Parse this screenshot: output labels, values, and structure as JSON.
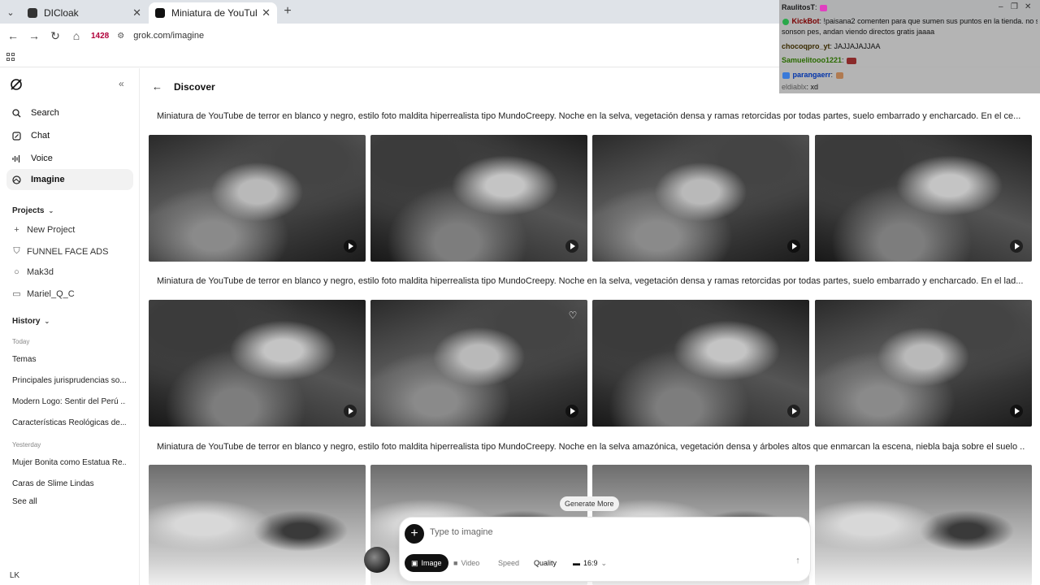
{
  "browser": {
    "tabs": [
      {
        "title": "DICloak",
        "favicon_color": "#333333"
      },
      {
        "title": "Miniatura de YouTube de terror",
        "favicon_color": "#111111"
      }
    ],
    "new_tab": "+",
    "badge_count": "1428",
    "url": "grok.com/imagine"
  },
  "sidebar": {
    "menu": [
      {
        "label": "Search",
        "icon": "search-icon"
      },
      {
        "label": "Chat",
        "icon": "chat-icon"
      },
      {
        "label": "Voice",
        "icon": "voice-icon"
      },
      {
        "label": "Imagine",
        "icon": "imagine-icon"
      }
    ],
    "projects_header": "Projects",
    "projects": [
      {
        "label": "New Project",
        "icon": "plus-icon"
      },
      {
        "label": "FUNNEL FACE ADS",
        "icon": "project-icon"
      },
      {
        "label": "Mak3d",
        "icon": "project-icon"
      },
      {
        "label": "Mariel_Q_C",
        "icon": "project-icon"
      }
    ],
    "history_header": "History",
    "today_label": "Today",
    "today": [
      "Temas",
      "Principales jurisprudencias so...",
      "Modern Logo: Sentir del Perú ...",
      "Características Reológicas de..."
    ],
    "yesterday_label": "Yesterday",
    "yesterday": [
      "Mujer Bonita como Estatua Re...",
      "Caras de Slime Lindas"
    ],
    "see_all": "See all",
    "avatar": "LK"
  },
  "main": {
    "title": "Discover",
    "prompts": [
      "Miniatura de YouTube de terror en blanco y negro, estilo foto maldita hiperrealista tipo MundoCreepy. Noche en la selva, vegetación densa y ramas retorcidas por todas partes, suelo embarrado y encharcado. En el ce...",
      "Miniatura de YouTube de terror en blanco y negro, estilo foto maldita hiperrealista tipo MundoCreepy. Noche en la selva, vegetación densa y ramas retorcidas por todas partes, suelo embarrado y encharcado. En el lad...",
      "Miniatura de YouTube de terror en blanco y negro, estilo foto maldita hiperrealista tipo MundoCreepy. Noche en la selva amazónica, vegetación densa y árboles altos que enmarcan la escena, niebla baja sobre el suelo ..."
    ],
    "generate_more": "Generate More"
  },
  "composer": {
    "placeholder": "Type to imagine",
    "image_label": "Image",
    "video_label": "Video",
    "speed_label": "Speed",
    "quality_label": "Quality",
    "ratio_label": "16:9"
  },
  "chat": {
    "lines": [
      {
        "user": "RaulitosT",
        "text": ":",
        "user_color": "#1a1a1a"
      },
      {
        "user": "KickBot",
        "text": ": !paisana2 comenten para que sumen sus puntos en la tienda. no s",
        "user_color": "#7a0000"
      },
      {
        "user": "",
        "text": "sonson pes, andan viendo directos gratis jaaaa",
        "user_color": "#1a1a1a"
      },
      {
        "user": "chocoqpro_yt",
        "text": ": JAJJAJAJJAA",
        "user_color": "#3a2b00"
      },
      {
        "user": "Samuelitooo1221",
        "text": ":",
        "user_color": "#2a6a00"
      },
      {
        "user": "parangaerr",
        "text": ":",
        "user_color": "#0033aa"
      },
      {
        "user": "eldiablx",
        "text": ": xd",
        "user_color": "#555555"
      }
    ]
  },
  "colors": {
    "accent": "#111111",
    "sidebar_active": "#f2f2f2",
    "chat_bg": "#aaaaaa"
  }
}
